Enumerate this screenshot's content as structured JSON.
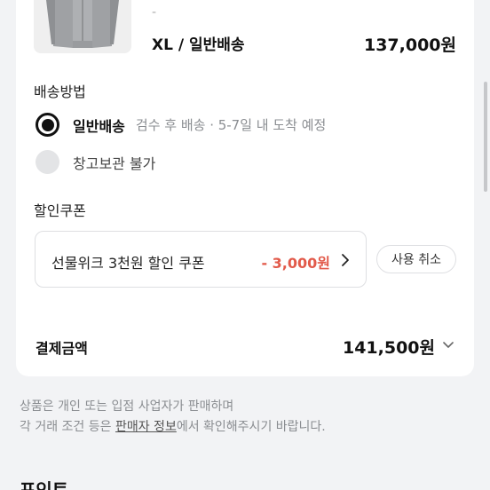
{
  "product": {
    "dash": "-",
    "option": "XL / 일반배송",
    "price": "137,000원"
  },
  "shipping": {
    "title": "배송방법",
    "options": [
      {
        "label": "일반배송",
        "desc": "검수 후 배송 · 5-7일 내 도착 예정",
        "selected": true
      },
      {
        "label": "창고보관 불가",
        "desc": "",
        "selected": false
      }
    ]
  },
  "coupon": {
    "title": "할인쿠폰",
    "name": "선물위크 3천원 할인 쿠폰",
    "amount": "- 3,000원",
    "cancel_label": "사용 취소"
  },
  "payment": {
    "label": "결제금액",
    "amount": "141,500원"
  },
  "notice": {
    "line1": "상품은 개인 또는 입점 사업자가 판매하며",
    "line2_prefix": "각 거래 조건 등은 ",
    "line2_link": "판매자 정보",
    "line2_suffix": "에서 확인해주시기 바랍니다."
  },
  "points": {
    "title": "포인트"
  }
}
